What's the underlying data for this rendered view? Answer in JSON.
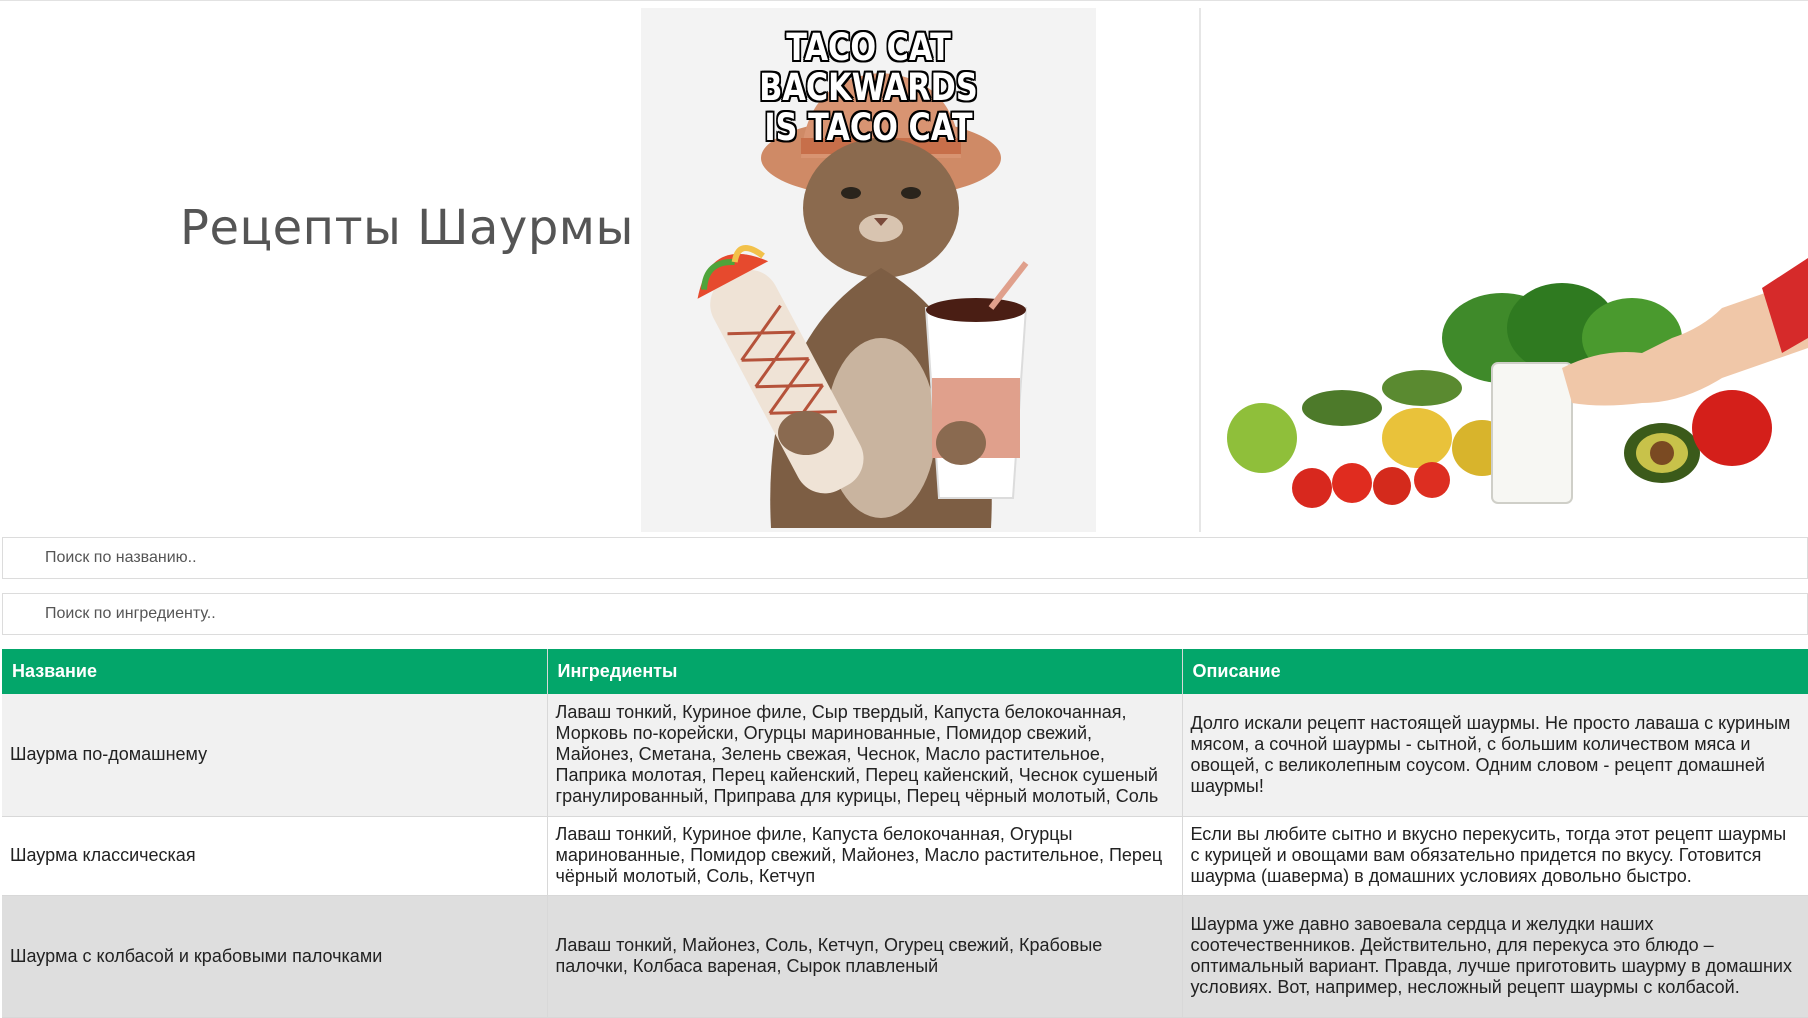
{
  "header": {
    "title": "Рецепты Шаурмы",
    "meme_caption_line1": "TACO CAT BACKWARDS",
    "meme_caption_line2": "IS TACO CAT"
  },
  "search": {
    "name_placeholder": "Поиск по названию..",
    "ingredient_placeholder": "Поиск по ингредиенту.."
  },
  "table": {
    "accent_color": "#03a66a",
    "columns": [
      "Название",
      "Ингредиенты",
      "Описание"
    ],
    "rows": [
      {
        "name": "Шаурма по-домашнему",
        "ingredients": "Лаваш тонкий, Куриное филе, Сыр твердый, Капуста белокочанная, Морковь по-корейски, Огурцы маринованные, Помидор свежий, Майонез, Сметана, Зелень свежая, Чеснок, Масло растительное, Паприка молотая, Перец кайенский, Перец кайенский, Чеснок сушеный гранулированный, Приправа для курицы, Перец чёрный молотый, Соль",
        "description": "Долго искали рецепт настоящей шаурмы. Не просто лаваша с куриным мясом, а сочной шаурмы - сытной, с большим количеством мяса и овощей, с великолепным соусом. Одним словом - рецепт домашней шаурмы!"
      },
      {
        "name": "Шаурма классическая",
        "ingredients": "Лаваш тонкий, Куриное филе, Капуста белокочанная, Огурцы маринованные, Помидор свежий, Майонез, Масло растительное, Перец чёрный молотый, Соль, Кетчуп",
        "description": "Если вы любите сытно и вкусно перекусить, тогда этот рецепт шаурмы с курицей и овощами вам обязательно придется по вкусу. Готовится шаурма (шаверма) в домашних условиях довольно быстро."
      },
      {
        "name": "Шаурма с колбасой и крабовыми палочками",
        "ingredients": "Лаваш тонкий, Майонез, Соль, Кетчуп, Огурец свежий, Крабовые палочки, Колбаса вареная, Сырок плавленый",
        "description": "Шаурма уже давно завоевала сердца и желудки наших соотечественников. Действительно, для перекуса это блюдо – оптимальный вариант. Правда, лучше приготовить шаурму в домашних условиях. Вот, например, несложный рецепт шаурмы с колбасой."
      }
    ]
  }
}
